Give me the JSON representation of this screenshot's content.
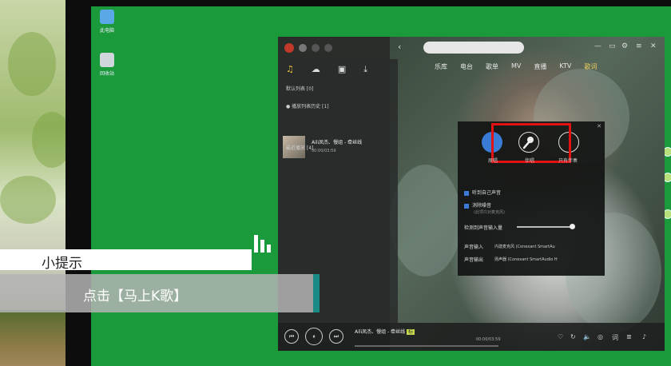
{
  "desktop": {
    "icons": [
      {
        "label": "此电脑",
        "icon": "computer-icon"
      },
      {
        "label": "回收站",
        "icon": "recycle-bin-icon"
      }
    ]
  },
  "player": {
    "tabs": [
      {
        "label": "乐库",
        "active": false
      },
      {
        "label": "电台",
        "active": false
      },
      {
        "label": "歌单",
        "active": false
      },
      {
        "label": "MV",
        "active": false
      },
      {
        "label": "直播",
        "active": false
      },
      {
        "label": "KTV",
        "active": false
      },
      {
        "label": "歌词",
        "active": true
      }
    ],
    "sidebar": {
      "icon_names": [
        "music-note-icon",
        "cloud-icon",
        "device-icon",
        "download-icon"
      ],
      "items": [
        {
          "label": "默认列表 [0]"
        },
        {
          "label": "● 播放列表历史 [1]"
        },
        {
          "label": "最近播放 [4]"
        }
      ],
      "song": {
        "title": "Aili凤杰、慢组 - 牵丝线",
        "time": "00:00/03:59"
      }
    },
    "popup": {
      "mode_labels": [
        "原唱",
        "伴唱",
        "只有伴奏"
      ],
      "options": [
        {
          "label": "听到自己声音",
          "checked": true
        },
        {
          "label": "消除噪音",
          "checked": true,
          "note": "(此项只对麦克风)"
        }
      ],
      "mic_volume_label": "检测到声音输入量",
      "input_label": "声音输入",
      "input_value": "内建麦克风 (Conexant SmartAu",
      "output_label": "声音输出",
      "output_value": "扬声器 (Conexant SmartAudio H"
    },
    "bottom": {
      "now_playing": "Aili凤杰、慢组 - 牵丝线",
      "time": "00:00/03:59",
      "quality_badge": "标"
    },
    "colors": {
      "highlight": "#e21212",
      "active_tab": "#f0d060",
      "desktop_green": "#1a9a3a"
    }
  },
  "tip": {
    "title": "小提示",
    "text": "点击【马上K歌】"
  }
}
